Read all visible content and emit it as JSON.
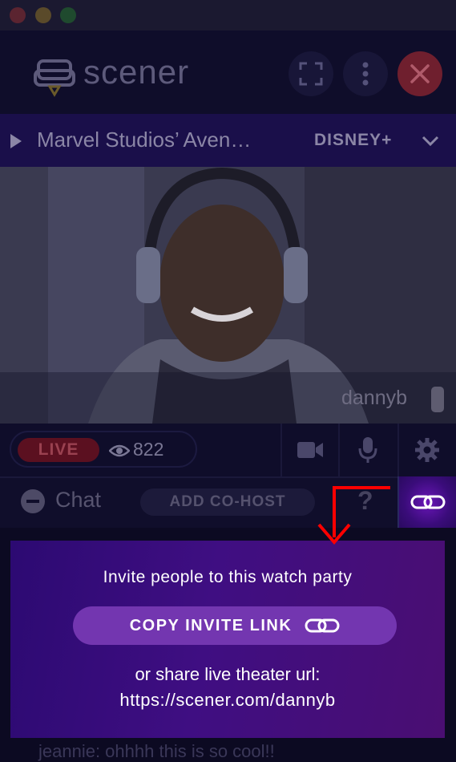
{
  "app": {
    "logo_text": "scener"
  },
  "now_playing": {
    "title": "Marvel Studios’ Aven…",
    "service": "DISNEY+"
  },
  "video": {
    "user_name": "dannyb"
  },
  "controls": {
    "live_label": "LIVE",
    "viewer_count": "822"
  },
  "chat_bar": {
    "chat_label": "Chat",
    "add_cohost_label": "ADD CO-HOST",
    "help_label": "?"
  },
  "invite_popup": {
    "heading": "Invite people to this watch party",
    "copy_button_label": "COPY INVITE LINK",
    "share_text": "or share live theater url:",
    "share_url": "https://scener.com/dannyb"
  },
  "chat_preview": {
    "text": "jeannie: ohhhh this is so cool!!"
  },
  "colors": {
    "accent": "#7336b0",
    "popup_bg": "#3f0e82",
    "arrow": "#ff0000",
    "live": "#5b1020"
  },
  "icons": [
    "logo-couch-icon",
    "fullscreen-icon",
    "more-vertical-icon",
    "close-icon",
    "play-icon",
    "chevron-down-icon",
    "remote-icon",
    "eye-icon",
    "camera-icon",
    "mic-icon",
    "gear-icon",
    "minus-circle-icon",
    "help-icon",
    "link-icon"
  ]
}
